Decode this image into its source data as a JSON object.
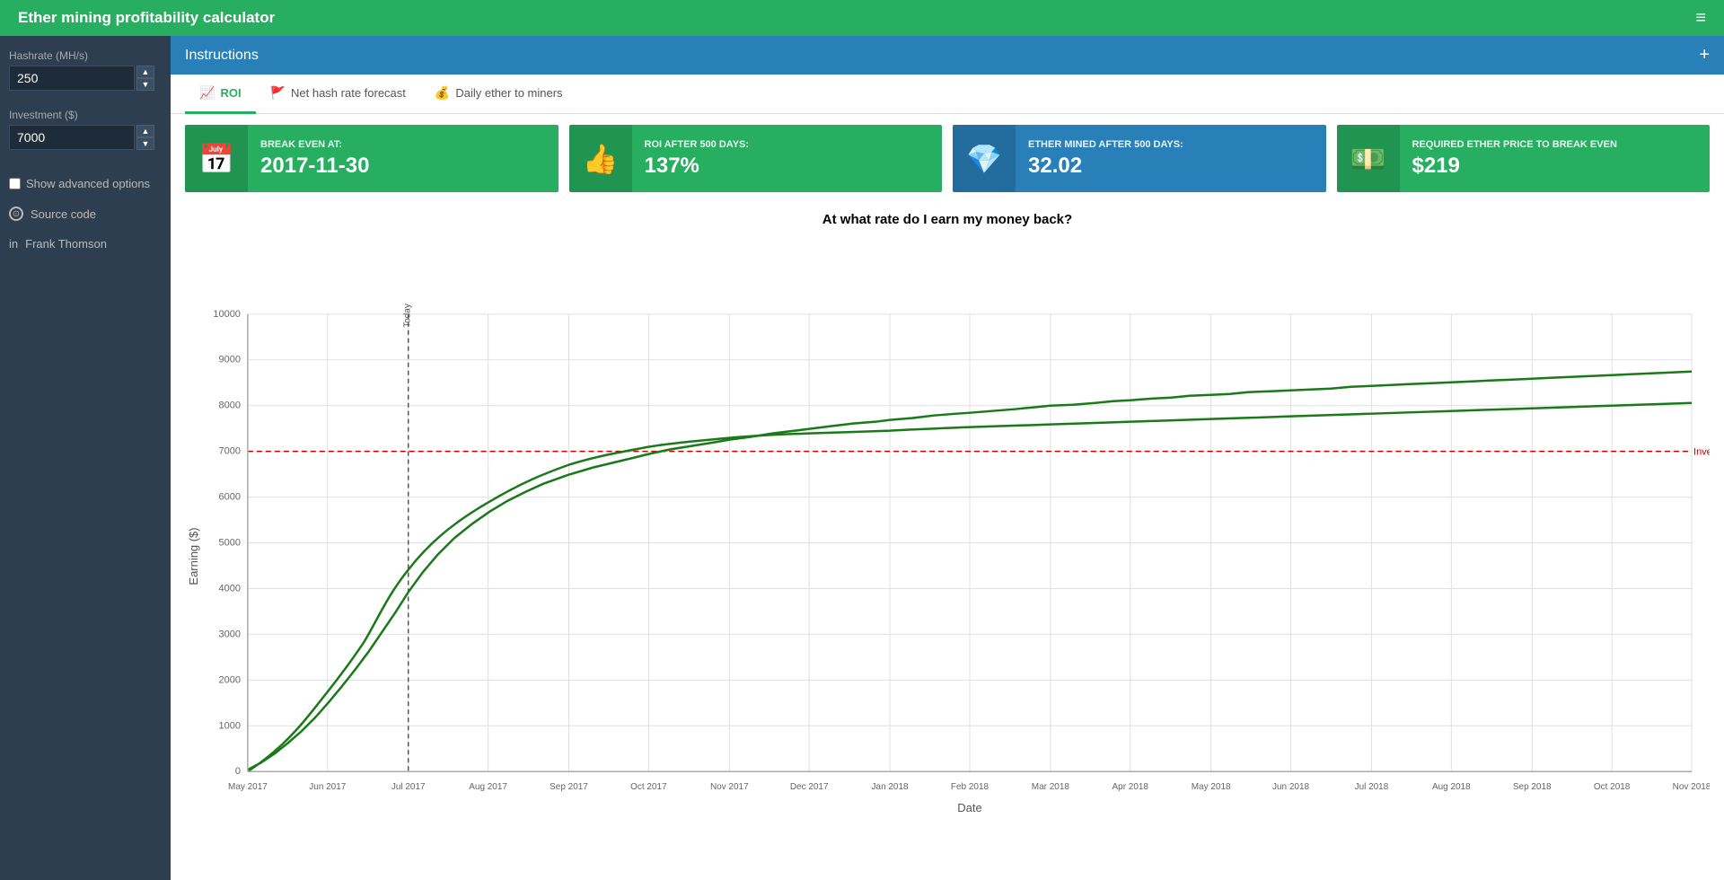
{
  "header": {
    "title": "Ether mining profitability calculator",
    "hamburger_icon": "≡"
  },
  "sidebar": {
    "hashrate_label": "Hashrate (MH/s)",
    "hashrate_value": "250",
    "investment_label": "Investment ($)",
    "investment_value": "7000",
    "advanced_options_label": "Show advanced options",
    "source_code_label": "Source code",
    "linkedin_label": "Frank Thomson"
  },
  "instructions_bar": {
    "label": "Instructions",
    "plus": "+"
  },
  "tabs": [
    {
      "id": "roi",
      "label": "ROI",
      "icon": "📈",
      "active": true
    },
    {
      "id": "hashrate",
      "label": "Net hash rate forecast",
      "icon": "🚩",
      "active": false
    },
    {
      "id": "daily",
      "label": "Daily ether to miners",
      "icon": "💰",
      "active": false
    }
  ],
  "stat_cards": [
    {
      "id": "break-even",
      "color": "green",
      "icon": "📅",
      "label": "BREAK EVEN AT:",
      "value": "2017-11-30"
    },
    {
      "id": "roi",
      "color": "green",
      "icon": "👍",
      "label": "ROI AFTER 500 DAYS:",
      "value": "137%"
    },
    {
      "id": "ether-mined",
      "color": "blue",
      "icon": "💎",
      "label": "ETHER MINED AFTER 500 DAYS:",
      "value": "32.02"
    },
    {
      "id": "required-price",
      "color": "green",
      "icon": "💵",
      "label": "REQUIRED ETHER PRICE TO BREAK EVEN",
      "value": "$219"
    }
  ],
  "chart": {
    "title": "At what rate do I earn my money back?",
    "x_label": "Date",
    "y_label": "Earning ($)",
    "today_label": "Today",
    "investment_label": "Investment",
    "investment_value": 7000,
    "x_ticks": [
      "May 2017",
      "Jun 2017",
      "Jul 2017",
      "Aug 2017",
      "Sep 2017",
      "Oct 2017",
      "Nov 2017",
      "Dec 2017",
      "Jan 2018",
      "Feb 2018",
      "Mar 2018",
      "Apr 2018",
      "May 2018",
      "Jun 2018",
      "Jul 2018",
      "Aug 2018",
      "Sep 2018",
      "Oct 2018",
      "Nov 2018"
    ],
    "y_ticks": [
      0,
      1000,
      2000,
      3000,
      4000,
      5000,
      6000,
      7000,
      8000,
      9000,
      10000
    ],
    "colors": {
      "curve": "#1a7a1a",
      "investment_line": "#cc0000",
      "today_line": "#555",
      "grid": "#e0e0e0"
    }
  }
}
